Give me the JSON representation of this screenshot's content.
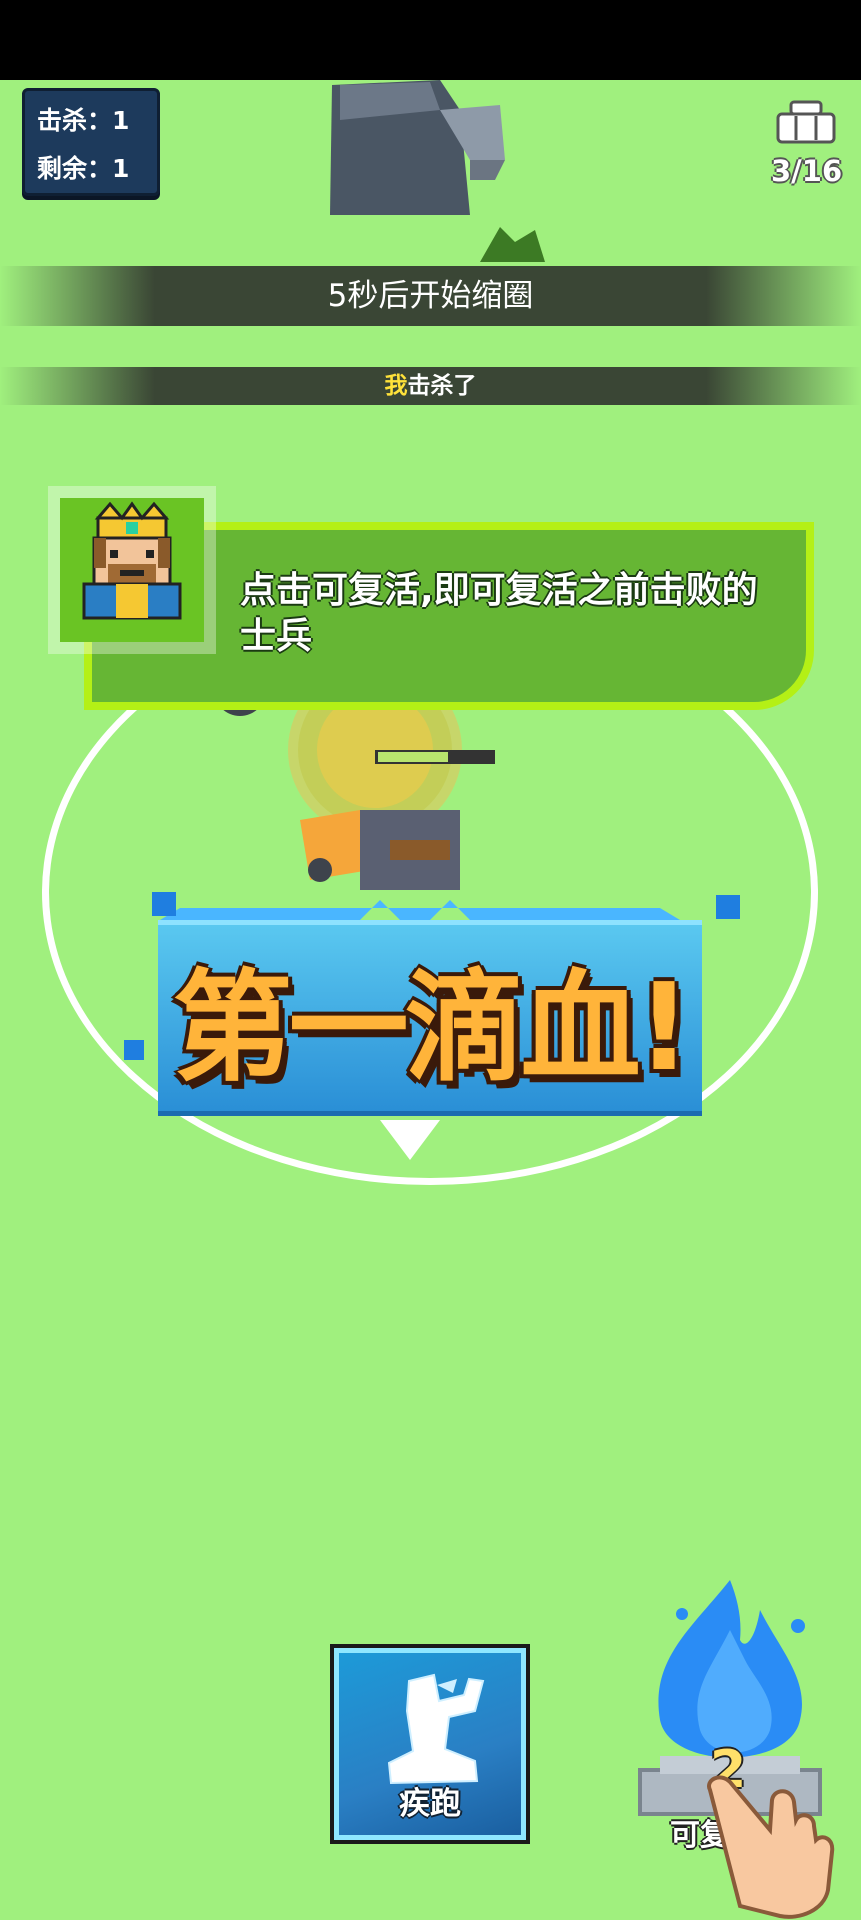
{
  "hud": {
    "kills_label": "击杀：1",
    "remaining_label": "剩余：1",
    "players_count": "3/16"
  },
  "banners": {
    "countdown": "5秒后开始缩圈",
    "kill_feed_me": "我",
    "kill_feed_rest": "击杀了"
  },
  "tip": {
    "text": "点击可复活,即可复活之前击败的士兵"
  },
  "announcement": {
    "text": "第一滴血!"
  },
  "skills": {
    "sprint_label": "疾跑",
    "revive_count": "2",
    "revive_label": "可复活"
  },
  "icons": {
    "players": "players-icon",
    "avatar": "king-avatar-icon",
    "sprint": "boot-icon",
    "revive": "blue-flame-icon",
    "tutorial": "hand-pointer-icon"
  },
  "colors": {
    "ground": "#a0f07e",
    "accent_green": "#b4f016",
    "highlight_yellow": "#ffe23a"
  }
}
